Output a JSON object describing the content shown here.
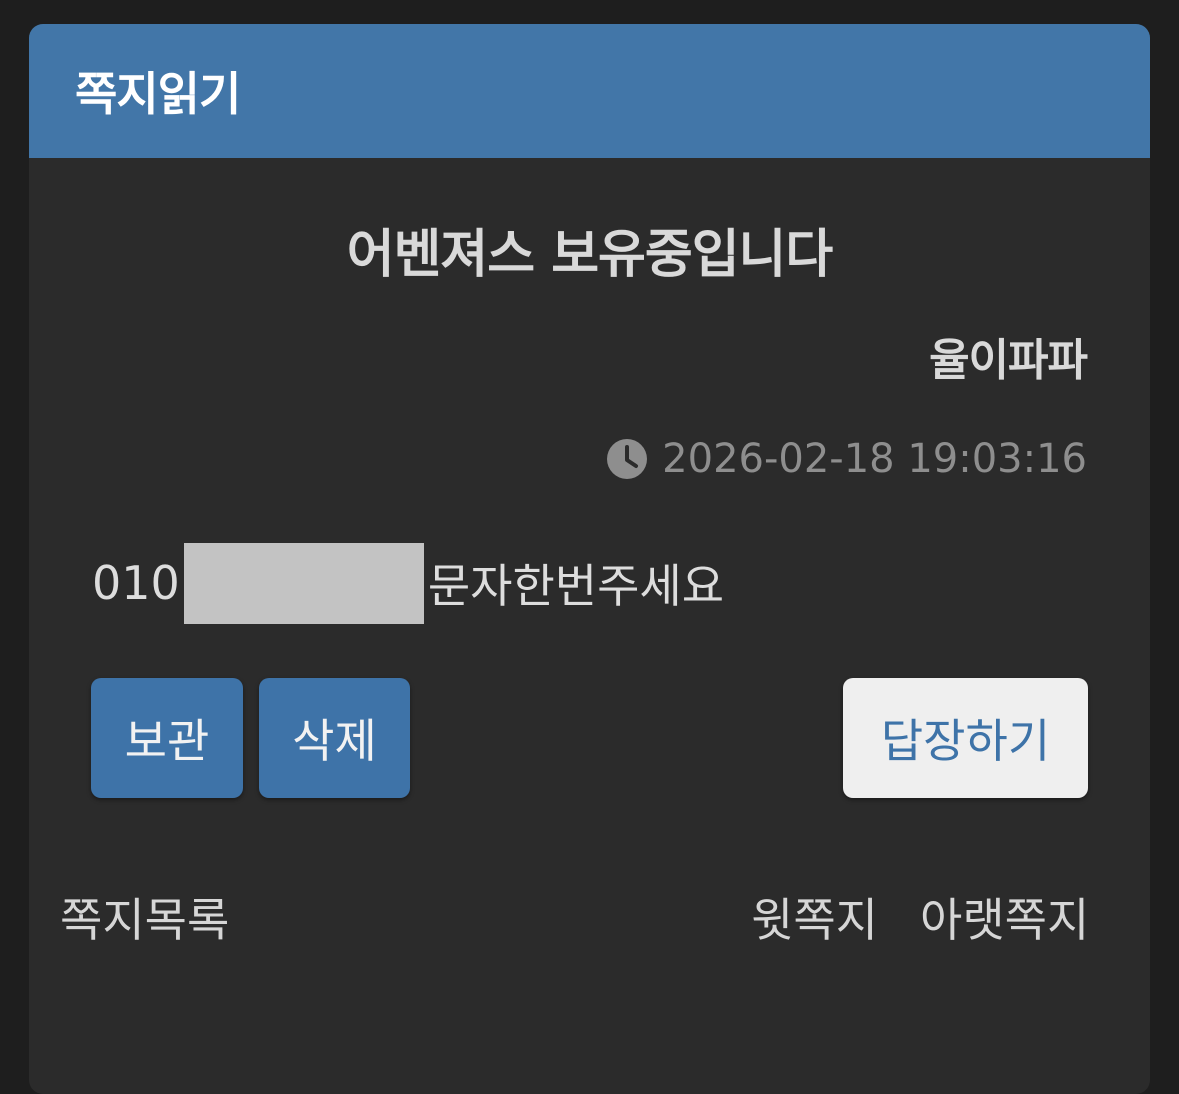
{
  "header": {
    "title": "쪽지읽기"
  },
  "message": {
    "subject": "어벤져스 보유중입니다",
    "sender": "율이파파",
    "timestamp": "2026-02-18 19:03:16",
    "body_prefix": "010",
    "body_suffix": "문자한번주세요"
  },
  "actions": {
    "archive_label": "보관",
    "delete_label": "삭제",
    "reply_label": "답장하기"
  },
  "footer": {
    "list_label": "쪽지목록",
    "prev_label": "윗쪽지",
    "next_label": "아랫쪽지"
  },
  "colors": {
    "accent": "#4276a8",
    "background": "#2b2b2b",
    "reply_button": "#efefef"
  },
  "icons": {
    "timestamp": "clock-icon"
  }
}
